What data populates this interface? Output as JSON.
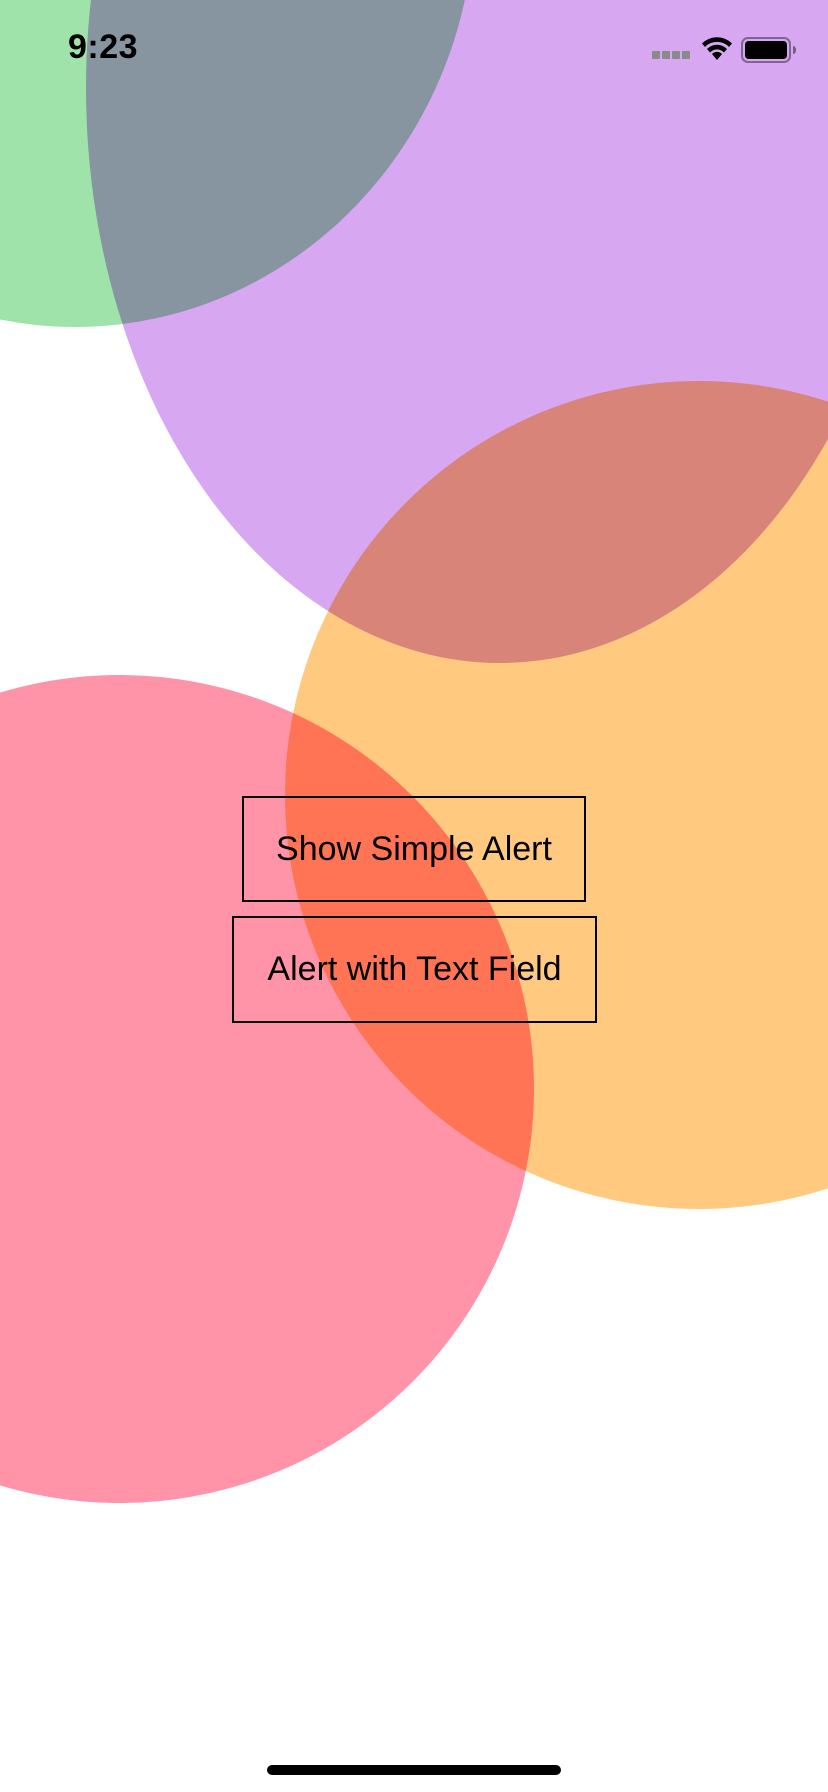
{
  "status_bar": {
    "time": "9:23",
    "signal_icon": "cellular-signal-icon",
    "wifi_icon": "wifi-icon",
    "battery_icon": "battery-full-icon"
  },
  "background": {
    "circles": [
      {
        "name": "green",
        "color": "#9fe3ab"
      },
      {
        "name": "purple",
        "color": "#d8a7f1"
      },
      {
        "name": "orange",
        "color": "#ffc980"
      },
      {
        "name": "pink",
        "color": "#ff93a8"
      }
    ]
  },
  "buttons": {
    "simple_alert_label": "Show Simple Alert",
    "text_field_alert_label": "Alert with Text Field"
  }
}
